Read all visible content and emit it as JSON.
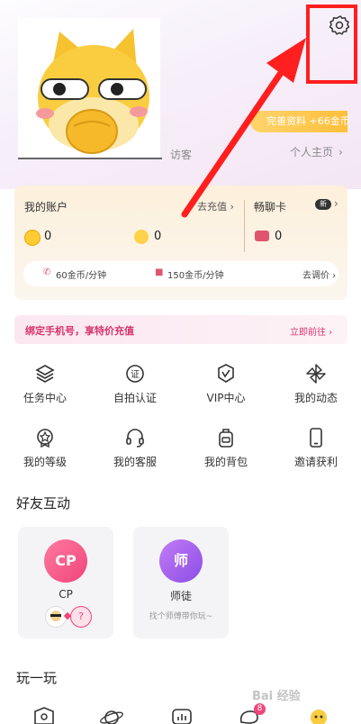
{
  "profile": {
    "badge_text": "完善资料 +66金币",
    "visitor_label": "访客",
    "homepage_label": "个人主页",
    "chevron": "›"
  },
  "account": {
    "title": "我的账户",
    "recharge_label": "去充值",
    "gold_coins": "0",
    "moon_coins": "0",
    "chat_card_label": "畅聊卡",
    "chat_card_badge": "新",
    "chat_card_count": "0",
    "voice_price": "60金币/分钟",
    "video_price": "150金币/分钟",
    "adjust_price_label": "去调价"
  },
  "banner": {
    "text": "绑定手机号，享特价充值",
    "action": "立即前往"
  },
  "menu": [
    {
      "label": "任务中心",
      "icon": "layers-icon"
    },
    {
      "label": "自拍认证",
      "icon": "certify-icon"
    },
    {
      "label": "VIP中心",
      "icon": "vip-icon"
    },
    {
      "label": "我的动态",
      "icon": "pinwheel-icon"
    },
    {
      "label": "我的等级",
      "icon": "level-icon"
    },
    {
      "label": "我的客服",
      "icon": "headset-icon"
    },
    {
      "label": "我的背包",
      "icon": "backpack-icon"
    },
    {
      "label": "邀请获利",
      "icon": "phone-icon"
    }
  ],
  "friends": {
    "title": "好友互动",
    "cards": [
      {
        "badge": "CP",
        "name": "CP",
        "sub": ""
      },
      {
        "badge": "师",
        "name": "师徒",
        "sub": "找个师傅带你玩~"
      }
    ],
    "question_mark": "?"
  },
  "play": {
    "title": "玩一玩",
    "notif_badge": "8"
  },
  "colors": {
    "accent_pink": "#d6336c",
    "highlight_red": "#ff1f1f",
    "gold": "#ffbf3b"
  },
  "watermark": "Bai 经验"
}
